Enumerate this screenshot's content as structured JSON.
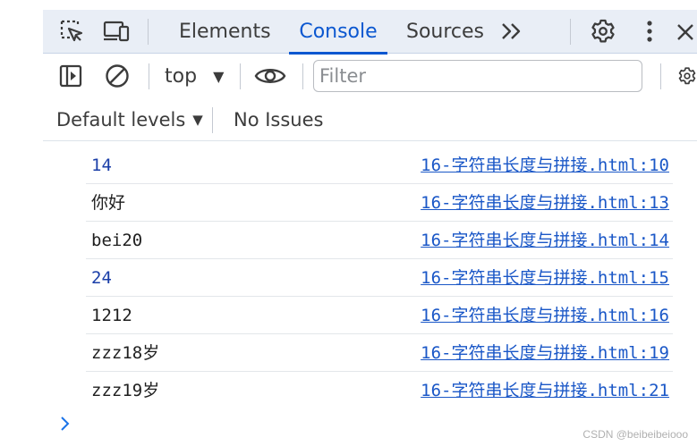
{
  "tabs": {
    "items": [
      {
        "label": "Elements"
      },
      {
        "label": "Console",
        "active": true
      },
      {
        "label": "Sources"
      }
    ],
    "more_icon": "chevron-double-right-icon",
    "accent_color": "#0b57d0"
  },
  "toolbar": {
    "context": "top",
    "filter_placeholder": "Filter"
  },
  "levels": {
    "label": "Default levels",
    "issues": "No Issues"
  },
  "messages": [
    {
      "value": "14",
      "kind": "number",
      "source": "16-字符串长度与拼接.html:10"
    },
    {
      "value": "你好",
      "kind": "string",
      "source": "16-字符串长度与拼接.html:13"
    },
    {
      "value": "bei20",
      "kind": "string",
      "source": "16-字符串长度与拼接.html:14"
    },
    {
      "value": "24",
      "kind": "number",
      "source": "16-字符串长度与拼接.html:15"
    },
    {
      "value": "1212",
      "kind": "string",
      "source": "16-字符串长度与拼接.html:16"
    },
    {
      "value": "zzz18岁",
      "kind": "string",
      "source": "16-字符串长度与拼接.html:19"
    },
    {
      "value": "zzz19岁",
      "kind": "string",
      "source": "16-字符串长度与拼接.html:21"
    }
  ],
  "watermark": "CSDN @beibeibeiooo"
}
